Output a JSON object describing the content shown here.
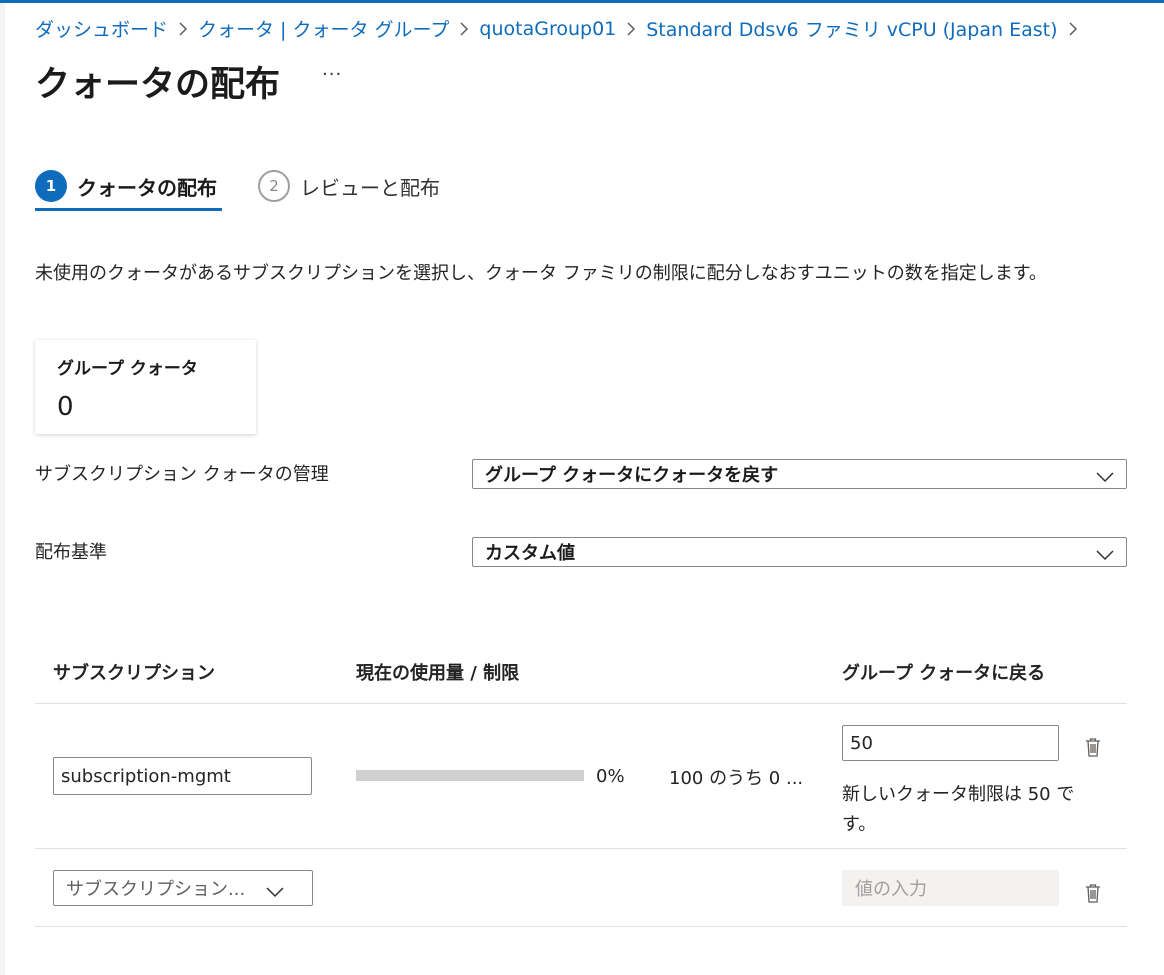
{
  "breadcrumb": [
    {
      "label": "ダッシュボード"
    },
    {
      "label": "クォータ | クォータ グループ"
    },
    {
      "label": "quotaGroup01"
    },
    {
      "label": "Standard Ddsv6 ファミリ vCPU (Japan East)"
    }
  ],
  "page": {
    "title": "クォータの配布",
    "more_label": "···"
  },
  "steps": [
    {
      "number": "1",
      "label": "クォータの配布",
      "active": true
    },
    {
      "number": "2",
      "label": "レビューと配布",
      "active": false
    }
  ],
  "description": "未使用のクォータがあるサブスクリプションを選択し、クォータ ファミリの制限に配分しなおすユニットの数を指定します。",
  "group_quota": {
    "label": "グループ クォータ",
    "value": "0"
  },
  "form": {
    "manage_label": "サブスクリプション クォータの管理",
    "manage_value": "グループ クォータにクォータを戻す",
    "basis_label": "配布基準",
    "basis_value": "カスタム値"
  },
  "table": {
    "headers": {
      "subscription": "サブスクリプション",
      "usage": "現在の使用量 / 制限",
      "return": "グループ クォータに戻る"
    },
    "rows": [
      {
        "subscription": "subscription-mgmt",
        "usage_percent_label": "0%",
        "usage_fraction": 0,
        "usage_text": "100 のうち 0 ...",
        "return_value": "50",
        "hint": "新しいクォータ制限は 50 です。"
      }
    ],
    "new_row": {
      "subscription_placeholder": "サブスクリプション...",
      "value_placeholder": "値の入力"
    }
  },
  "colors": {
    "accent": "#0f6cbd",
    "border": "#8a8886",
    "track": "#d2d0ce"
  }
}
